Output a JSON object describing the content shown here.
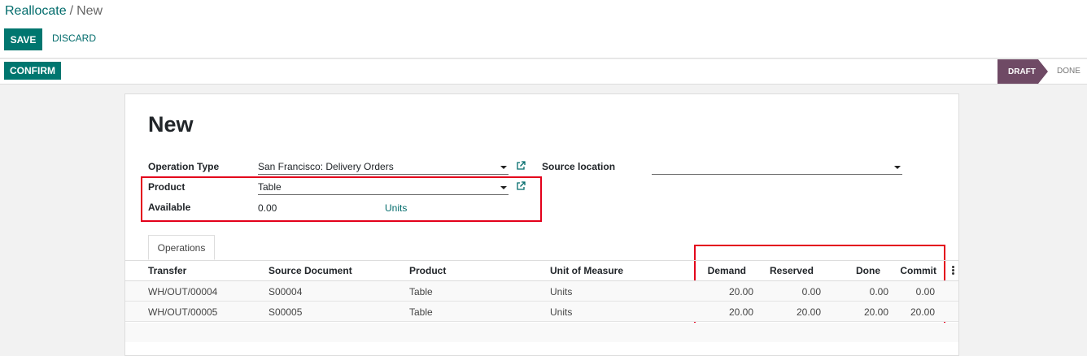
{
  "breadcrumb": {
    "parent": "Reallocate",
    "separator": "/",
    "current": "New"
  },
  "toolbar": {
    "save_label": "SAVE",
    "discard_label": "DISCARD"
  },
  "statusbar": {
    "confirm_label": "CONFIRM",
    "stages": [
      "DRAFT",
      "DONE"
    ],
    "active_stage": "DRAFT"
  },
  "form": {
    "title": "New",
    "operation_type": {
      "label": "Operation Type",
      "value": "San Francisco: Delivery Orders"
    },
    "product": {
      "label": "Product",
      "value": "Table"
    },
    "available": {
      "label": "Available",
      "value": "0.00",
      "unit": "Units"
    },
    "source_location": {
      "label": "Source location",
      "value": ""
    }
  },
  "tabs": [
    {
      "label": "Operations"
    }
  ],
  "table": {
    "columns": [
      "Transfer",
      "Source Document",
      "Product",
      "Unit of Measure",
      "Demand",
      "Reserved",
      "Done",
      "Commit"
    ],
    "rows": [
      [
        "WH/OUT/00004",
        "S00004",
        "Table",
        "Units",
        "20.00",
        "0.00",
        "0.00",
        "0.00"
      ],
      [
        "WH/OUT/00005",
        "S00005",
        "Table",
        "Units",
        "20.00",
        "20.00",
        "20.00",
        "20.00"
      ]
    ]
  },
  "colors": {
    "primary": "#00766f",
    "link": "#016b6b",
    "active_stage": "#6f4a65",
    "annotation": "#e3001b"
  }
}
